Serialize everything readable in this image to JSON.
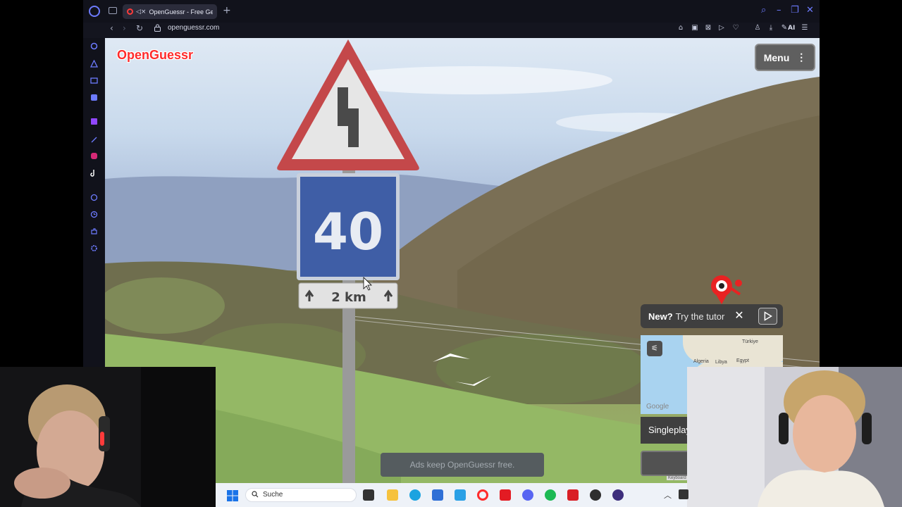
{
  "browser": {
    "tab_title": "OpenGuessr - Free Geo",
    "url": "openguessr.com",
    "ai_label": "AI"
  },
  "game": {
    "logo": "OpenGuessr",
    "menu_label": "Menu",
    "tutorial_new": "New?",
    "tutorial_text": "Try the tutor",
    "singleplayer": "Singleplay",
    "ads_text": "Ads keep OpenGuessr free.",
    "keyboard_label": "Keyboard",
    "google_mark": "Google",
    "minimap_labels": [
      "Türkiye",
      "Algeria",
      "Libya",
      "Egypt"
    ]
  },
  "scene": {
    "sign_speed": "40",
    "sign_distance": "2 km"
  },
  "taskbar": {
    "search_placeholder": "Suche"
  },
  "colors": {
    "opera_accent": "#6d7bff",
    "openguessr_red": "#ff2b2b",
    "sign_blue": "#3f5ea6"
  }
}
